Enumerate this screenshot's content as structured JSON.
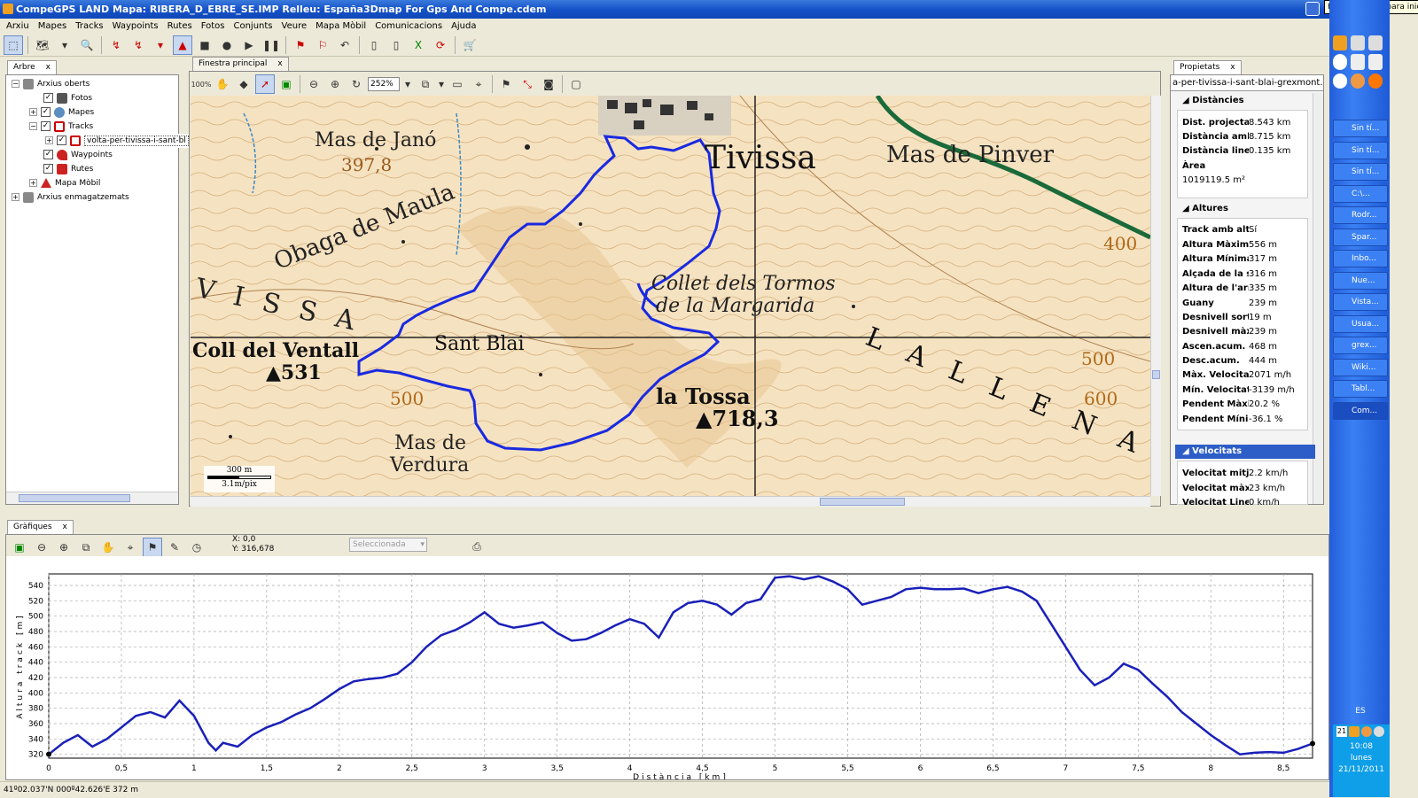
{
  "window": {
    "title": "CompeGPS LAND Mapa: RIBERA_D_EBRE_SE.IMP Relleu: España3Dmap For Gps And Compe.cdem",
    "tooltip": "Haga clic aquí para iniciar"
  },
  "menu": [
    "Arxiu",
    "Mapes",
    "Tracks",
    "Waypoints",
    "Rutes",
    "Fotos",
    "Conjunts",
    "Veure",
    "Mapa Mòbil",
    "Comunicacions",
    "Ajuda"
  ],
  "tree": {
    "tab": "Arbre",
    "items": [
      {
        "label": "Arxius oberts"
      },
      {
        "label": "Fotos"
      },
      {
        "label": "Mapes"
      },
      {
        "label": "Tracks"
      },
      {
        "label": "volta-per-tivissa-i-sant-bl"
      },
      {
        "label": "Waypoints"
      },
      {
        "label": "Rutes"
      },
      {
        "label": "Mapa Mòbil"
      },
      {
        "label": "Arxius enmagatzemats"
      }
    ]
  },
  "main": {
    "tab": "Finestra principal",
    "zoom": "252%"
  },
  "map": {
    "labels": {
      "mas_jano": "Mas de Janó",
      "mas_jano_alt": "397,8",
      "tivissa": "Tivissa",
      "mas_pinver": "Mas de Pinver",
      "obaga": "Obaga de Maula",
      "visa": "V I S S A",
      "collet": "Collet dels Tormos",
      "margarida": "de la Margarida",
      "coll_ventall": "Coll del Ventall",
      "alt_531": "▲531",
      "sant_blai": "Sant Blai",
      "la_tossa": "la Tossa",
      "alt_718": "▲718,3",
      "mas_verdura1": "Mas de",
      "mas_verdura2": "Verdura",
      "la_llena": "L A   L L E N A",
      "c400": "400",
      "c500a": "500",
      "c500b": "500",
      "c600": "600",
      "scale": "300 m",
      "scale_pix": "3.1m/pix"
    }
  },
  "properties": {
    "tab": "Propietats",
    "filename": "a-per-tivissa-i-sant-blai-grexmont.g",
    "distancies": {
      "title": "Distàncies",
      "rows": [
        {
          "k": "Dist. projectad",
          "v": "8.543 km"
        },
        {
          "k": "Distància amb",
          "v": "8.715 km"
        },
        {
          "k": "Distància lineal",
          "v": "0.135 km"
        },
        {
          "k": "Àrea",
          "v": ""
        },
        {
          "k": "1019119.5 m²",
          "v": ""
        }
      ]
    },
    "altures": {
      "title": "Altures",
      "rows": [
        {
          "k": "Track amb altu",
          "v": "Sí"
        },
        {
          "k": "Altura Màxima",
          "v": "556 m"
        },
        {
          "k": "Altura Mínima",
          "v": "317 m"
        },
        {
          "k": "Alçada de la sc",
          "v": "316 m"
        },
        {
          "k": "Altura de l'arril",
          "v": "335 m"
        },
        {
          "k": "Guany",
          "v": "239 m"
        },
        {
          "k": "Desnivell sortic",
          "v": "19 m"
        },
        {
          "k": "Desnivell màxir",
          "v": "239 m"
        },
        {
          "k": "Ascen.acum.",
          "v": "468 m"
        },
        {
          "k": "Desc.acum.",
          "v": "444 m"
        },
        {
          "k": "Màx. Velocitat",
          "v": "2071 m/h"
        },
        {
          "k": "Mín. Velocitat",
          "v": "-3139 m/h"
        },
        {
          "k": "Pendent Màxir",
          "v": "20.2 %"
        },
        {
          "k": "Pendent Mínin",
          "v": "-36.1 %"
        }
      ]
    },
    "velocitats": {
      "title": "Velocitats",
      "rows": [
        {
          "k": "Velocitat mitja",
          "v": "2.2 km/h"
        },
        {
          "k": "Velocitat màxi",
          "v": "23 km/h"
        },
        {
          "k": "Velocitat Linea",
          "v": "0 km/h"
        }
      ]
    }
  },
  "graph": {
    "tab": "Gràfiques",
    "x_readout": "X: 0,0",
    "y_readout": "Y: 316,678",
    "select_placeholder": "Seleccionada"
  },
  "chart_data": {
    "type": "line",
    "xlabel": "Distància [km]",
    "ylabel": "Altura track [m]",
    "xlim": [
      0,
      8.7
    ],
    "ylim": [
      315,
      555
    ],
    "xticks": [
      "0",
      "0,5",
      "1",
      "1,5",
      "2",
      "2,5",
      "3",
      "3,5",
      "4",
      "4,5",
      "5",
      "5,5",
      "6",
      "6,5",
      "7",
      "7,5",
      "8",
      "8,5"
    ],
    "yticks": [
      "320",
      "340",
      "360",
      "380",
      "400",
      "420",
      "440",
      "460",
      "480",
      "500",
      "520",
      "540"
    ],
    "series": [
      {
        "x": [
          0,
          0.1,
          0.2,
          0.3,
          0.4,
          0.5,
          0.6,
          0.7,
          0.8,
          0.9,
          1.0,
          1.1,
          1.15,
          1.2,
          1.3,
          1.4,
          1.5,
          1.6,
          1.7,
          1.8,
          1.9,
          2.0,
          2.1,
          2.2,
          2.3,
          2.4,
          2.5,
          2.6,
          2.7,
          2.8,
          2.9,
          3.0,
          3.1,
          3.2,
          3.3,
          3.4,
          3.5,
          3.6,
          3.7,
          3.8,
          3.9,
          4.0,
          4.1,
          4.2,
          4.3,
          4.4,
          4.5,
          4.6,
          4.7,
          4.8,
          4.9,
          5.0,
          5.1,
          5.2,
          5.3,
          5.4,
          5.5,
          5.6,
          5.7,
          5.8,
          5.9,
          6.0,
          6.1,
          6.2,
          6.3,
          6.4,
          6.5,
          6.6,
          6.7,
          6.8,
          6.9,
          7.0,
          7.1,
          7.2,
          7.3,
          7.4,
          7.5,
          7.6,
          7.7,
          7.8,
          7.9,
          8.0,
          8.1,
          8.2,
          8.3,
          8.4,
          8.5,
          8.6,
          8.7
        ],
        "y": [
          320,
          335,
          345,
          330,
          340,
          355,
          370,
          375,
          368,
          390,
          370,
          335,
          325,
          335,
          330,
          345,
          355,
          362,
          372,
          380,
          392,
          405,
          415,
          418,
          420,
          425,
          440,
          460,
          475,
          482,
          492,
          505,
          490,
          485,
          488,
          492,
          478,
          468,
          470,
          478,
          488,
          496,
          490,
          472,
          505,
          517,
          520,
          515,
          502,
          517,
          522,
          550,
          552,
          548,
          552,
          545,
          535,
          515,
          520,
          525,
          535,
          537,
          535,
          535,
          536,
          530,
          535,
          538,
          532,
          520,
          490,
          460,
          430,
          410,
          420,
          438,
          430,
          412,
          395,
          375,
          360,
          345,
          332,
          320,
          322,
          323,
          322,
          327,
          334
        ]
      }
    ]
  },
  "status": "41º02.037'N 000º42.626'E  372 m",
  "taskbar": {
    "tasks": [
      "Sin tí...",
      "Sin tí...",
      "Sin tí...",
      "C:\\...",
      "Rodr...",
      "Spar...",
      "Inbo...",
      "Nue...",
      "Vista...",
      "Usua...",
      "grex...",
      "Wiki...",
      "Tabl...",
      "Com..."
    ],
    "lang": "ES",
    "time": "10:08",
    "day": "lunes",
    "date": "21/11/2011",
    "calendar_badge": "21"
  }
}
